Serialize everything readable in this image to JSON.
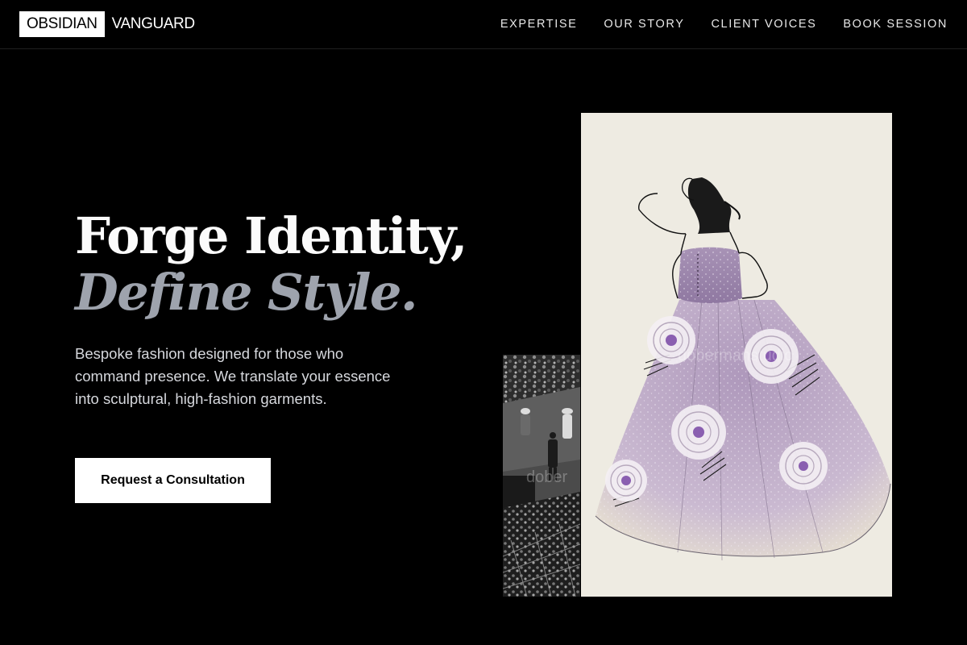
{
  "brand": {
    "part1": "OBSIDIAN",
    "part2": "VANGUARD"
  },
  "nav": {
    "items": [
      "EXPERTISE",
      "OUR STORY",
      "CLIENT VOICES",
      "BOOK SESSION"
    ]
  },
  "hero": {
    "title_line1": "Forge Identity,",
    "title_line2": "Define Style.",
    "description": "Bespoke fashion designed for those who command presence. We translate your essence into sculptural, high-fashion garments.",
    "cta_label": "Request a Consultation"
  },
  "images": {
    "runway_watermark": "dober",
    "sketch_watermark": "dobermanstudio"
  },
  "colors": {
    "background": "#000000",
    "title_accent": "#9ea3ad",
    "button_bg": "#ffffff",
    "gown": "#b9a5c4",
    "flower_center": "#8a5fb0"
  }
}
